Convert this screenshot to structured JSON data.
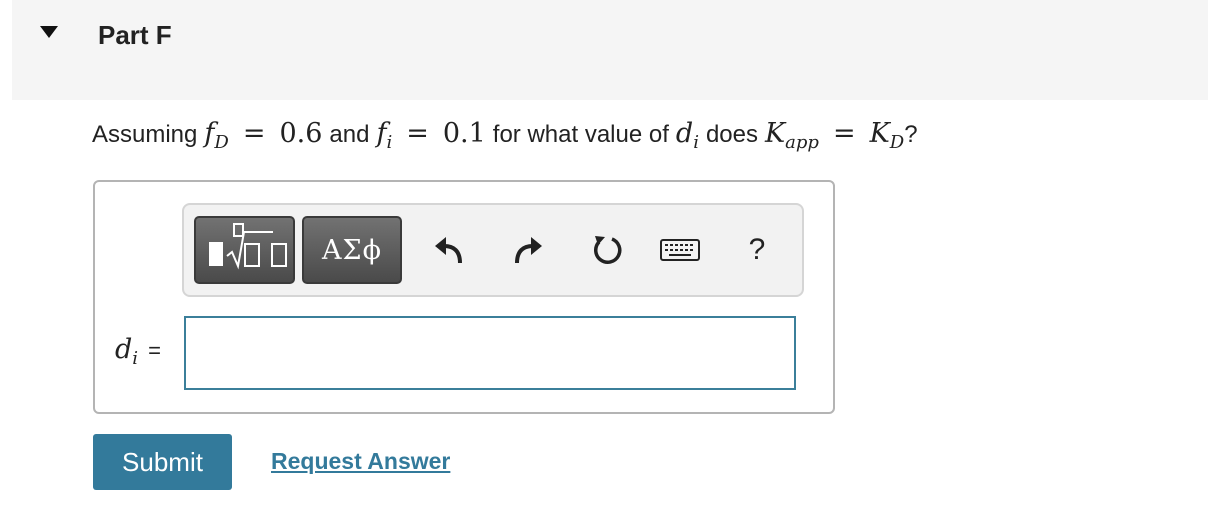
{
  "header": {
    "part_title": "Part F"
  },
  "question": {
    "prefix": "Assuming",
    "f": "f",
    "sub_D": "D",
    "eq": "=",
    "val_fD": "0.6",
    "and": "and",
    "sub_i": "i",
    "val_fi": "0.1",
    "middle": "for what value of",
    "d": "d",
    "does": "does",
    "K": "K",
    "sub_app": "app",
    "suffix": "?"
  },
  "toolbar": {
    "templates_icon": "template-sqrt-icon",
    "greek_label": "ΑΣϕ",
    "undo_icon": "undo-icon",
    "redo_icon": "redo-icon",
    "reset_icon": "reset-icon",
    "keyboard_icon": "keyboard-icon",
    "help_label": "?"
  },
  "answer": {
    "var": "d",
    "var_sub": "i",
    "equals": "=",
    "value": "",
    "placeholder": ""
  },
  "actions": {
    "submit_label": "Submit",
    "request_label": "Request Answer"
  },
  "colors": {
    "accent": "#337a9b",
    "input_border": "#3b7f9a",
    "header_bg": "#f5f5f5"
  }
}
